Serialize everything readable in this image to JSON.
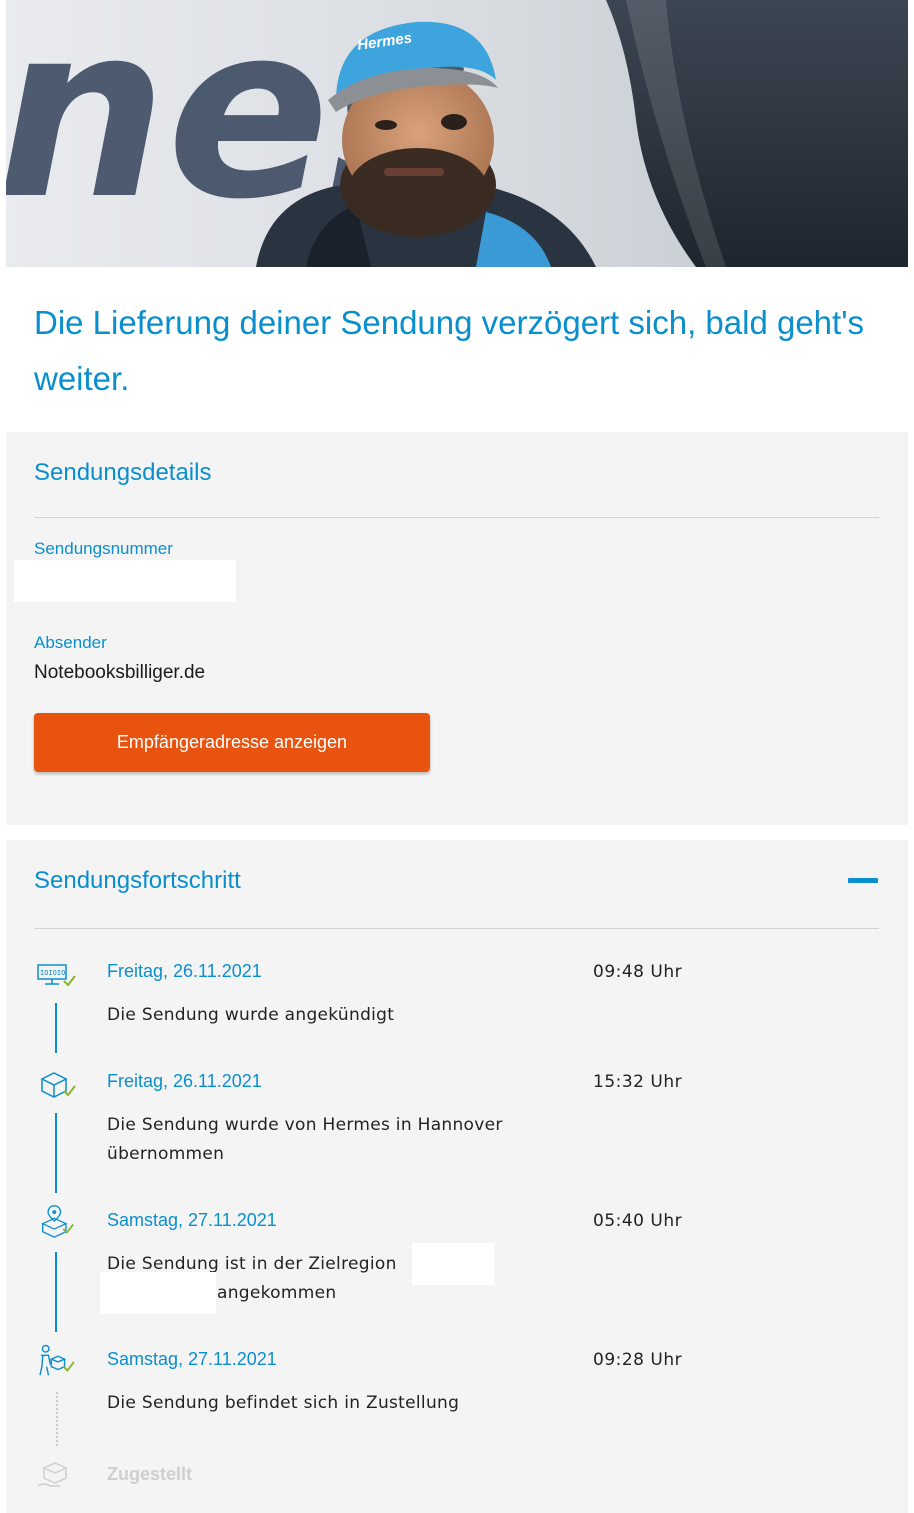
{
  "hero": {
    "logo_text": "Hermes",
    "background_letters": "nes"
  },
  "headline": "Die Lieferung deiner Sendung verzögert sich, bald geht's weiter.",
  "details": {
    "title": "Sendungsdetails",
    "tracking_label": "Sendungsnummer",
    "tracking_value": "",
    "sender_label": "Absender",
    "sender_value": "Notebooksbilliger.de",
    "address_button": "Empfängeradresse anzeigen"
  },
  "progress": {
    "title": "Sendungsfortschritt",
    "events": [
      {
        "icon": "announced-icon",
        "date": "Freitag, 26.11.2021",
        "time": "09:48 Uhr",
        "text": "Die Sendung wurde angekündigt"
      },
      {
        "icon": "package-received-icon",
        "date": "Freitag, 26.11.2021",
        "time": "15:32 Uhr",
        "text": "Die Sendung wurde von Hermes in Hannover übernommen"
      },
      {
        "icon": "package-location-icon",
        "date": "Samstag, 27.11.2021",
        "time": "05:40 Uhr",
        "text_before": "Die Sendung ist in der Zielregion",
        "text_after": "angekommen"
      },
      {
        "icon": "courier-delivery-icon",
        "date": "Samstag, 27.11.2021",
        "time": "09:28 Uhr",
        "text": "Die Sendung befindet sich in Zustellung"
      }
    ],
    "pending": {
      "icon": "delivered-icon",
      "label": "Zugestellt"
    }
  },
  "colors": {
    "accent": "#0a8fce",
    "button": "#e8540f",
    "panel": "#f4f4f4",
    "check": "#8ab22f"
  }
}
